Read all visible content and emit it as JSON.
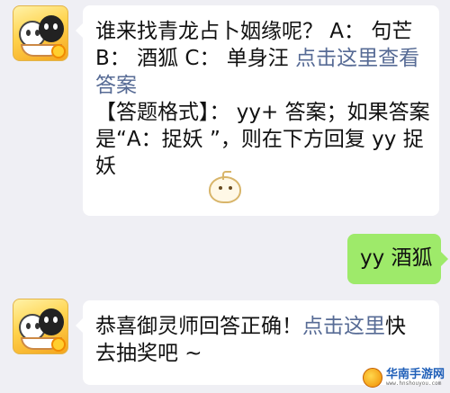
{
  "messages": [
    {
      "side": "left",
      "line1": "谁来找青龙占卜姻缘呢？ A： 句芒",
      "line2_text": "B： 酒狐 C： 单身汪 ",
      "line2_link": "点击这里查看",
      "line3_link": "答案",
      "line4": "【答题格式】：  yy+ 答案；如果答案",
      "line5": "是“A：捉妖 ”，则在下方回复 yy 捉",
      "line6": "妖"
    },
    {
      "side": "right",
      "text": "yy 酒狐"
    },
    {
      "side": "left",
      "line1_text": "恭喜御灵师回答正确！",
      "line1_link": "点击这里",
      "line1_tail": "快",
      "line2": "去抽奖吧 ~"
    }
  ],
  "watermark": {
    "title": "华南手游网",
    "sub": "www.hnshouyou.com"
  },
  "colors": {
    "background": "#efeff4",
    "bubble_left": "#ffffff",
    "bubble_right": "#9eea6a",
    "link": "#576b95"
  }
}
